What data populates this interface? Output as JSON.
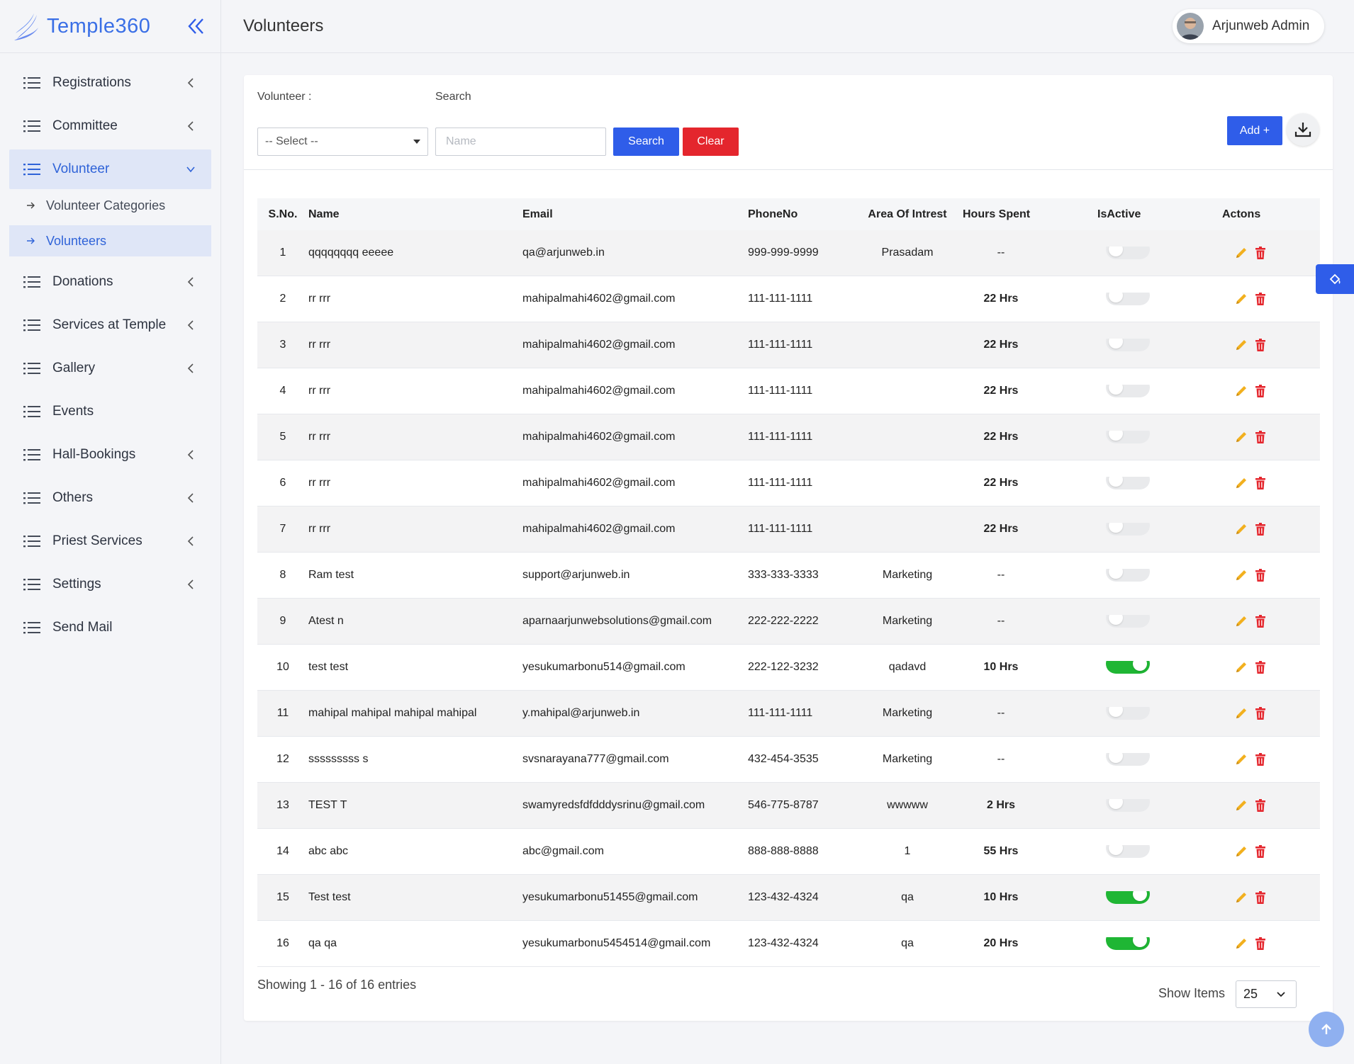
{
  "brand": {
    "name": "Temple360"
  },
  "header": {
    "title": "Volunteers",
    "user_name": "Arjunweb Admin"
  },
  "sidebar": {
    "items": [
      {
        "label": "Registrations",
        "has_chevron": true
      },
      {
        "label": "Committee",
        "has_chevron": true
      },
      {
        "label": "Volunteer",
        "has_chevron": true,
        "active": true
      },
      {
        "label": "Donations",
        "has_chevron": true
      },
      {
        "label": "Services at Temple",
        "has_chevron": true
      },
      {
        "label": "Gallery",
        "has_chevron": true
      },
      {
        "label": "Events",
        "has_chevron": false
      },
      {
        "label": "Hall-Bookings",
        "has_chevron": true
      },
      {
        "label": "Others",
        "has_chevron": true
      },
      {
        "label": "Priest Services",
        "has_chevron": true
      },
      {
        "label": "Settings",
        "has_chevron": true
      },
      {
        "label": "Send Mail",
        "has_chevron": false
      }
    ],
    "volunteer_sub": [
      {
        "label": "Volunteer Categories",
        "active": false
      },
      {
        "label": "Volunteers",
        "active": true
      }
    ]
  },
  "filters": {
    "volunteer_label": "Volunteer :",
    "volunteer_selected": "-- Select --",
    "search_label": "Search",
    "search_placeholder": "Name",
    "search_button": "Search",
    "clear_button": "Clear",
    "add_button": "Add +"
  },
  "table": {
    "headers": [
      "S.No.",
      "Name",
      "Email",
      "PhoneNo",
      "Area Of Intrest",
      "Hours Spent",
      "IsActive",
      "Actons"
    ],
    "rows": [
      {
        "sno": "1",
        "name": "qqqqqqqq eeeee",
        "email": "qa@arjunweb.in",
        "phone": "999-999-9999",
        "area": "Prasadam",
        "hours": "--",
        "active": false
      },
      {
        "sno": "2",
        "name": "rr rrr",
        "email": "mahipalmahi4602@gmail.com",
        "phone": "111-111-1111",
        "area": "",
        "hours": "22 Hrs",
        "active": false
      },
      {
        "sno": "3",
        "name": "rr rrr",
        "email": "mahipalmahi4602@gmail.com",
        "phone": "111-111-1111",
        "area": "",
        "hours": "22 Hrs",
        "active": false
      },
      {
        "sno": "4",
        "name": "rr rrr",
        "email": "mahipalmahi4602@gmail.com",
        "phone": "111-111-1111",
        "area": "",
        "hours": "22 Hrs",
        "active": false
      },
      {
        "sno": "5",
        "name": "rr rrr",
        "email": "mahipalmahi4602@gmail.com",
        "phone": "111-111-1111",
        "area": "",
        "hours": "22 Hrs",
        "active": false
      },
      {
        "sno": "6",
        "name": "rr rrr",
        "email": "mahipalmahi4602@gmail.com",
        "phone": "111-111-1111",
        "area": "",
        "hours": "22 Hrs",
        "active": false
      },
      {
        "sno": "7",
        "name": "rr rrr",
        "email": "mahipalmahi4602@gmail.com",
        "phone": "111-111-1111",
        "area": "",
        "hours": "22 Hrs",
        "active": false
      },
      {
        "sno": "8",
        "name": "Ram test",
        "email": "support@arjunweb.in",
        "phone": "333-333-3333",
        "area": "Marketing",
        "hours": "--",
        "active": false
      },
      {
        "sno": "9",
        "name": "Atest n",
        "email": "aparnaarjunwebsolutions@gmail.com",
        "phone": "222-222-2222",
        "area": "Marketing",
        "hours": "--",
        "active": false
      },
      {
        "sno": "10",
        "name": "test test",
        "email": "yesukumarbonu514@gmail.com",
        "phone": "222-122-3232",
        "area": "qadavd",
        "hours": "10 Hrs",
        "active": true
      },
      {
        "sno": "11",
        "name": "mahipal mahipal mahipal mahipal",
        "email": "y.mahipal@arjunweb.in",
        "phone": "111-111-1111",
        "area": "Marketing",
        "hours": "--",
        "active": false
      },
      {
        "sno": "12",
        "name": "sssssssss s",
        "email": "svsnarayana777@gmail.com",
        "phone": "432-454-3535",
        "area": "Marketing",
        "hours": "--",
        "active": false
      },
      {
        "sno": "13",
        "name": "TEST T",
        "email": "swamyredsfdfdddysrinu@gmail.com",
        "phone": "546-775-8787",
        "area": "wwwww",
        "hours": "2 Hrs",
        "active": false
      },
      {
        "sno": "14",
        "name": "abc abc",
        "email": "abc@gmail.com",
        "phone": "888-888-8888",
        "area": "1",
        "hours": "55 Hrs",
        "active": false
      },
      {
        "sno": "15",
        "name": "Test test",
        "email": "yesukumarbonu51455@gmail.com",
        "phone": "123-432-4324",
        "area": "qa",
        "hours": "10 Hrs",
        "active": true
      },
      {
        "sno": "16",
        "name": "qa qa",
        "email": "yesukumarbonu5454514@gmail.com",
        "phone": "123-432-4324",
        "area": "qa",
        "hours": "20 Hrs",
        "active": true
      }
    ]
  },
  "footer": {
    "showing": "Showing 1 - 16 of 16 entries",
    "show_items_label": "Show Items",
    "show_items_value": "25"
  },
  "colors": {
    "primary": "#2f5de9",
    "danger": "#e4262d",
    "toggle_on": "#1fb634",
    "edit_icon": "#f2b01e",
    "delete_icon": "#e4262d"
  }
}
